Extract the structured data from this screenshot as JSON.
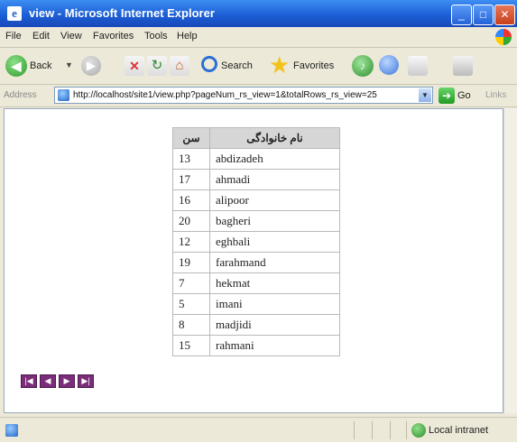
{
  "window": {
    "title": "view - Microsoft Internet Explorer"
  },
  "menubar": {
    "items": [
      "File",
      "Edit",
      "View",
      "Favorites",
      "Tools",
      "Help"
    ]
  },
  "toolbar": {
    "back_label": "Back",
    "search_label": "Search",
    "favorites_label": "Favorites"
  },
  "addressbar": {
    "label": "Address",
    "url": "http://localhost/site1/view.php?pageNum_rs_view=1&totalRows_rs_view=25",
    "go_label": "Go",
    "links_label": "Links"
  },
  "table": {
    "headers": [
      "سن",
      "نام خانوادگی"
    ],
    "rows": [
      {
        "age": "13",
        "name": "abdizadeh"
      },
      {
        "age": "17",
        "name": "ahmadi"
      },
      {
        "age": "16",
        "name": "alipoor"
      },
      {
        "age": "20",
        "name": "bagheri"
      },
      {
        "age": "12",
        "name": "eghbali"
      },
      {
        "age": "19",
        "name": "farahmand"
      },
      {
        "age": "7",
        "name": "hekmat"
      },
      {
        "age": "5",
        "name": "imani"
      },
      {
        "age": "8",
        "name": "madjidi"
      },
      {
        "age": "15",
        "name": "rahmani"
      }
    ]
  },
  "pager": {
    "buttons": [
      "first",
      "previous",
      "next",
      "last"
    ]
  },
  "statusbar": {
    "zone": "Local intranet"
  }
}
